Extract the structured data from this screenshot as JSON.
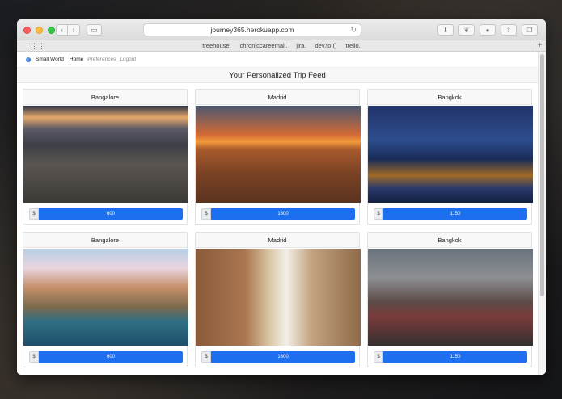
{
  "browser": {
    "url": "journey365.herokuapp.com",
    "bookmarks": [
      "treehouse.",
      "chroniccareemail.",
      "jira.",
      "dev.to ()",
      "trello."
    ]
  },
  "app": {
    "brand": "Small World",
    "nav": [
      "Home",
      "Preferences",
      "Logout"
    ]
  },
  "feed": {
    "title": "Your Personalized Trip Feed",
    "currency_symbol": "$",
    "cards": [
      {
        "city": "Bangalore",
        "price": "600"
      },
      {
        "city": "Madrid",
        "price": "1300"
      },
      {
        "city": "Bangkok",
        "price": "1150"
      },
      {
        "city": "Bangalore",
        "price": "600"
      },
      {
        "city": "Madrid",
        "price": "1300"
      },
      {
        "city": "Bangkok",
        "price": "1150"
      }
    ]
  },
  "colors": {
    "accent": "#1e6ff0"
  }
}
